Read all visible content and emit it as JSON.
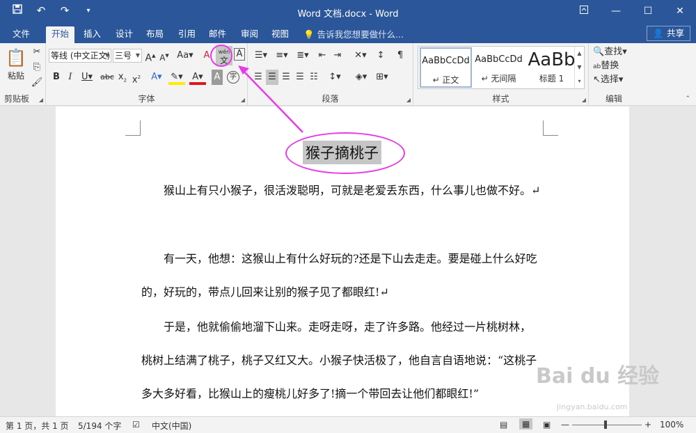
{
  "window": {
    "title": "Word 文档.docx - Word"
  },
  "qat": {
    "save_icon": "💾",
    "undo_icon": "↶",
    "redo_icon": "↷",
    "customize_icon": "▾"
  },
  "tabs": [
    {
      "label": "文件"
    },
    {
      "label": "开始"
    },
    {
      "label": "插入"
    },
    {
      "label": "设计"
    },
    {
      "label": "布局"
    },
    {
      "label": "引用"
    },
    {
      "label": "邮件"
    },
    {
      "label": "审阅"
    },
    {
      "label": "视图"
    }
  ],
  "tell_me": "告诉我您想要做什么...",
  "share": "共享",
  "clipboard": {
    "paste_label": "粘贴",
    "group_label": "剪贴板"
  },
  "font": {
    "name": "等线 (中文正文)",
    "size": "三号",
    "group_label": "字体",
    "phonetic_top": "wén",
    "phonetic_bottom": "文"
  },
  "paragraph": {
    "group_label": "段落"
  },
  "styles": {
    "group_label": "样式",
    "items": [
      {
        "preview": "AaBbCcDd",
        "name": "↵ 正文"
      },
      {
        "preview": "AaBbCcDd",
        "name": "↵ 无间隔"
      },
      {
        "preview": "AaBb",
        "name": "标题 1"
      }
    ]
  },
  "editing": {
    "find": "查找",
    "replace": "替换",
    "select": "选择",
    "group_label": "编辑"
  },
  "document": {
    "title": "猴子摘桃子",
    "paragraphs": [
      "猴山上有只小猴子，很活泼聪明，可就是老爱丢东西，什么事儿也做不好。↵",
      "有一天，他想：这猴山上有什么好玩的?还是下山去走走。要是碰上什么好吃的，好玩的，带点儿回来让别的猴子见了都眼红!↵",
      "于是，他就偷偷地溜下山来。走呀走呀，走了许多路。他经过一片桃树林，桃树上结满了桃子，桃子又红又大。小猴子快活极了，他自言自语地说：“这桃子多大多好看，比猴山上的瘦桃儿好多了!摘一个带回去让他们都眼红!”"
    ]
  },
  "status": {
    "page": "第 1 页，共 1 页",
    "words": "5/194 个字",
    "lang": "中文(中国)",
    "zoom": "100%"
  },
  "watermark": {
    "main": "Bai du 经验",
    "sub": "jingyan.baidu.com"
  }
}
